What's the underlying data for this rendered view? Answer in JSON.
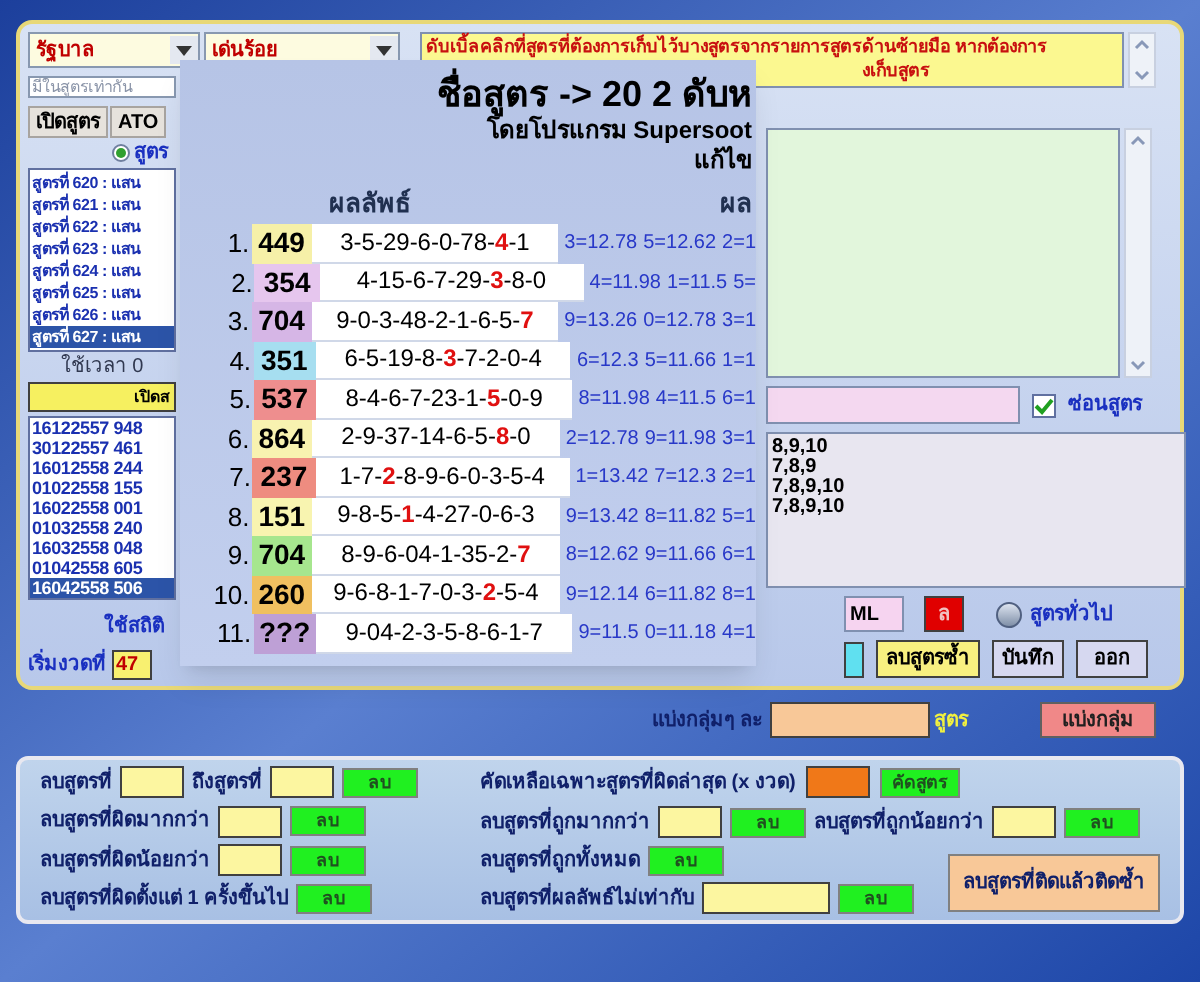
{
  "selectors": [
    {
      "value": "รัฐบาล"
    },
    {
      "value": "เด่นร้อย"
    }
  ],
  "notice": {
    "line_1": "ดับเบิ้ลคลิกที่สูตรที่ต้องการเก็บไว้บางสูตรจากรายการสูตรด้านซ้ายมือ หากต้องการ",
    "line_2": "งเก็บสูตร"
  },
  "match_field": {
    "placeholder": "มีในสูตรเท่ากัน"
  },
  "left_buttons": [
    "เปิดสูตร",
    "ATO"
  ],
  "formula_option": {
    "label": "สูตร",
    "selected": true
  },
  "formulas": [
    {
      "label": "สูตรที่ 620 : แสน",
      "selected": false
    },
    {
      "label": "สูตรที่ 621 : แสน",
      "selected": false
    },
    {
      "label": "สูตรที่ 622 : แสน",
      "selected": false
    },
    {
      "label": "สูตรที่ 623 : แสน",
      "selected": false
    },
    {
      "label": "สูตรที่ 624 : แสน",
      "selected": false
    },
    {
      "label": "สูตรที่ 625 : แสน",
      "selected": false
    },
    {
      "label": "สูตรที่ 626 : แสน",
      "selected": false
    },
    {
      "label": "สูตรที่ 627 : แสน",
      "selected": true
    }
  ],
  "elapsed": "ใช้เวลา 0",
  "open_button": "เปิดส",
  "draws": [
    {
      "label": "16122557 948",
      "selected": false
    },
    {
      "label": "30122557 461",
      "selected": false
    },
    {
      "label": "16012558 244",
      "selected": false
    },
    {
      "label": "01022558 155",
      "selected": false
    },
    {
      "label": "16022558 001",
      "selected": false
    },
    {
      "label": "01032558 240",
      "selected": false
    },
    {
      "label": "16032558 048",
      "selected": false
    },
    {
      "label": "01042558 605",
      "selected": false
    },
    {
      "label": "16042558 506",
      "selected": true
    }
  ],
  "use_stats": "ใช้สถิติ",
  "start_draw": {
    "label": "เริ่มงวดที่",
    "value": "47"
  },
  "popup": {
    "title": "ชื่อสูตร -> 20 2 ดับห",
    "subtitle": "โดยโปรแกรม Supersoot",
    "edit": "แก้ไข",
    "result_heading": "ผลลัพธ์",
    "stats_heading": "ผล",
    "rows": [
      {
        "index": "1.",
        "number": "449",
        "color": "#f6f0a8",
        "sequence": "3-5-29-6-0-78-**4**-1",
        "stats": [
          "3=12.78",
          "5=12.62",
          "2=1"
        ]
      },
      {
        "index": "2.",
        "number": "354",
        "color": "#e6c6ee",
        "sequence": "4-15-6-7-29-**3**-8-0",
        "stats": [
          "4=11.98",
          "1=11.5",
          "5="
        ]
      },
      {
        "index": "3.",
        "number": "704",
        "color": "#d6b6e6",
        "sequence": "9-0-3-48-2-1-6-5-**7**",
        "stats": [
          "9=13.26",
          "0=12.78",
          "3=1"
        ]
      },
      {
        "index": "4.",
        "number": "351",
        "color": "#a6def0",
        "sequence": "6-5-19-8-**3**-7-2-0-4",
        "stats": [
          "6=12.3",
          "5=11.66",
          "1=1"
        ]
      },
      {
        "index": "5.",
        "number": "537",
        "color": "#ee8e8e",
        "sequence": "8-4-6-7-23-1-**5**-0-9",
        "stats": [
          "8=11.98",
          "4=11.5",
          "6=1"
        ]
      },
      {
        "index": "6.",
        "number": "864",
        "color": "#f8f2b0",
        "sequence": "2-9-37-14-6-5-**8**-0",
        "stats": [
          "2=12.78",
          "9=11.98",
          "3=1"
        ]
      },
      {
        "index": "7.",
        "number": "237",
        "color": "#ee8c80",
        "sequence": "1-7-**2**-8-9-6-0-3-5-4",
        "stats": [
          "1=13.42",
          "7=12.3",
          "2=1"
        ]
      },
      {
        "index": "8.",
        "number": "151",
        "color": "#f8f4b0",
        "sequence": "9-8-5-**1**-4-27-0-6-3",
        "stats": [
          "9=13.42",
          "8=11.82",
          "5=1"
        ]
      },
      {
        "index": "9.",
        "number": "704",
        "color": "#a6e68e",
        "sequence": "8-9-6-04-1-35-2-**7**",
        "stats": [
          "8=12.62",
          "9=11.66",
          "6=1"
        ]
      },
      {
        "index": "10.",
        "number": "260",
        "color": "#f0c060",
        "sequence": "9-6-8-1-7-0-3-**2**-5-4",
        "stats": [
          "9=12.14",
          "6=11.82",
          "8=1"
        ]
      },
      {
        "index": "11.",
        "number": "???",
        "color": "#bea0d6",
        "sequence": "9-04-2-3-5-8-6-1-7",
        "stats": [
          "9=11.5",
          "0=11.18",
          "4=1"
        ]
      }
    ]
  },
  "hide_formulas": {
    "label": "ซ่อนสูตร",
    "checked": true
  },
  "list_lines": [
    "8,9,10",
    "7,8,9",
    "7,8,9,10",
    "7,8,9,10"
  ],
  "ml_field": {
    "value": "ML"
  },
  "red_button": "ล",
  "general_option": {
    "label": "สูตรทั่วไป",
    "selected": false
  },
  "action_buttons": [
    "ลบสูตรซ้ำ",
    "บันทึก",
    "ออก"
  ],
  "grouping": {
    "label": "แบ่งกลุ่มๆ ละ",
    "unit": "สูตร",
    "button": "แบ่งกลุ่ม"
  },
  "delete_range": {
    "from_label": "ลบสูตรที่",
    "to_label": "ถึงสูตรที่",
    "button": "ลบ"
  },
  "left_rules": [
    {
      "label": "ลบสูตรที่ผิดมากกว่า",
      "kind": "field",
      "button": "ลบ"
    },
    {
      "label": "ลบสูตรที่ผิดน้อยกว่า",
      "kind": "field",
      "button": "ลบ"
    },
    {
      "label": "ลบสูตรที่ผิดตั้งแต่ 1 ครั้งขึ้นไป",
      "kind": "plain",
      "button": "ลบ"
    }
  ],
  "keep_latest": {
    "label": "คัดเหลือเฉพาะสูตรที่ผิดล่าสุด (x งวด)",
    "button": "คัดสูตร"
  },
  "right_rules": [
    {
      "label": "ลบสูตรที่ถูกมากกว่า",
      "kind": "field",
      "button": "ลบ"
    },
    {
      "label": "ลบสูตรที่ถูกน้อยกว่า",
      "kind": "field",
      "button": "ลบ"
    },
    {
      "label": "ลบสูตรที่ถูกทั้งหมด",
      "kind": "plain",
      "button": "ลบ"
    },
    {
      "label": "ลบสูตรที่ผลลัพธ์ไม่เท่ากับ",
      "kind": "wide",
      "button": "ลบ"
    }
  ],
  "repeat_button": "ลบสูตรที่ติดแล้วติดซ้ำ"
}
